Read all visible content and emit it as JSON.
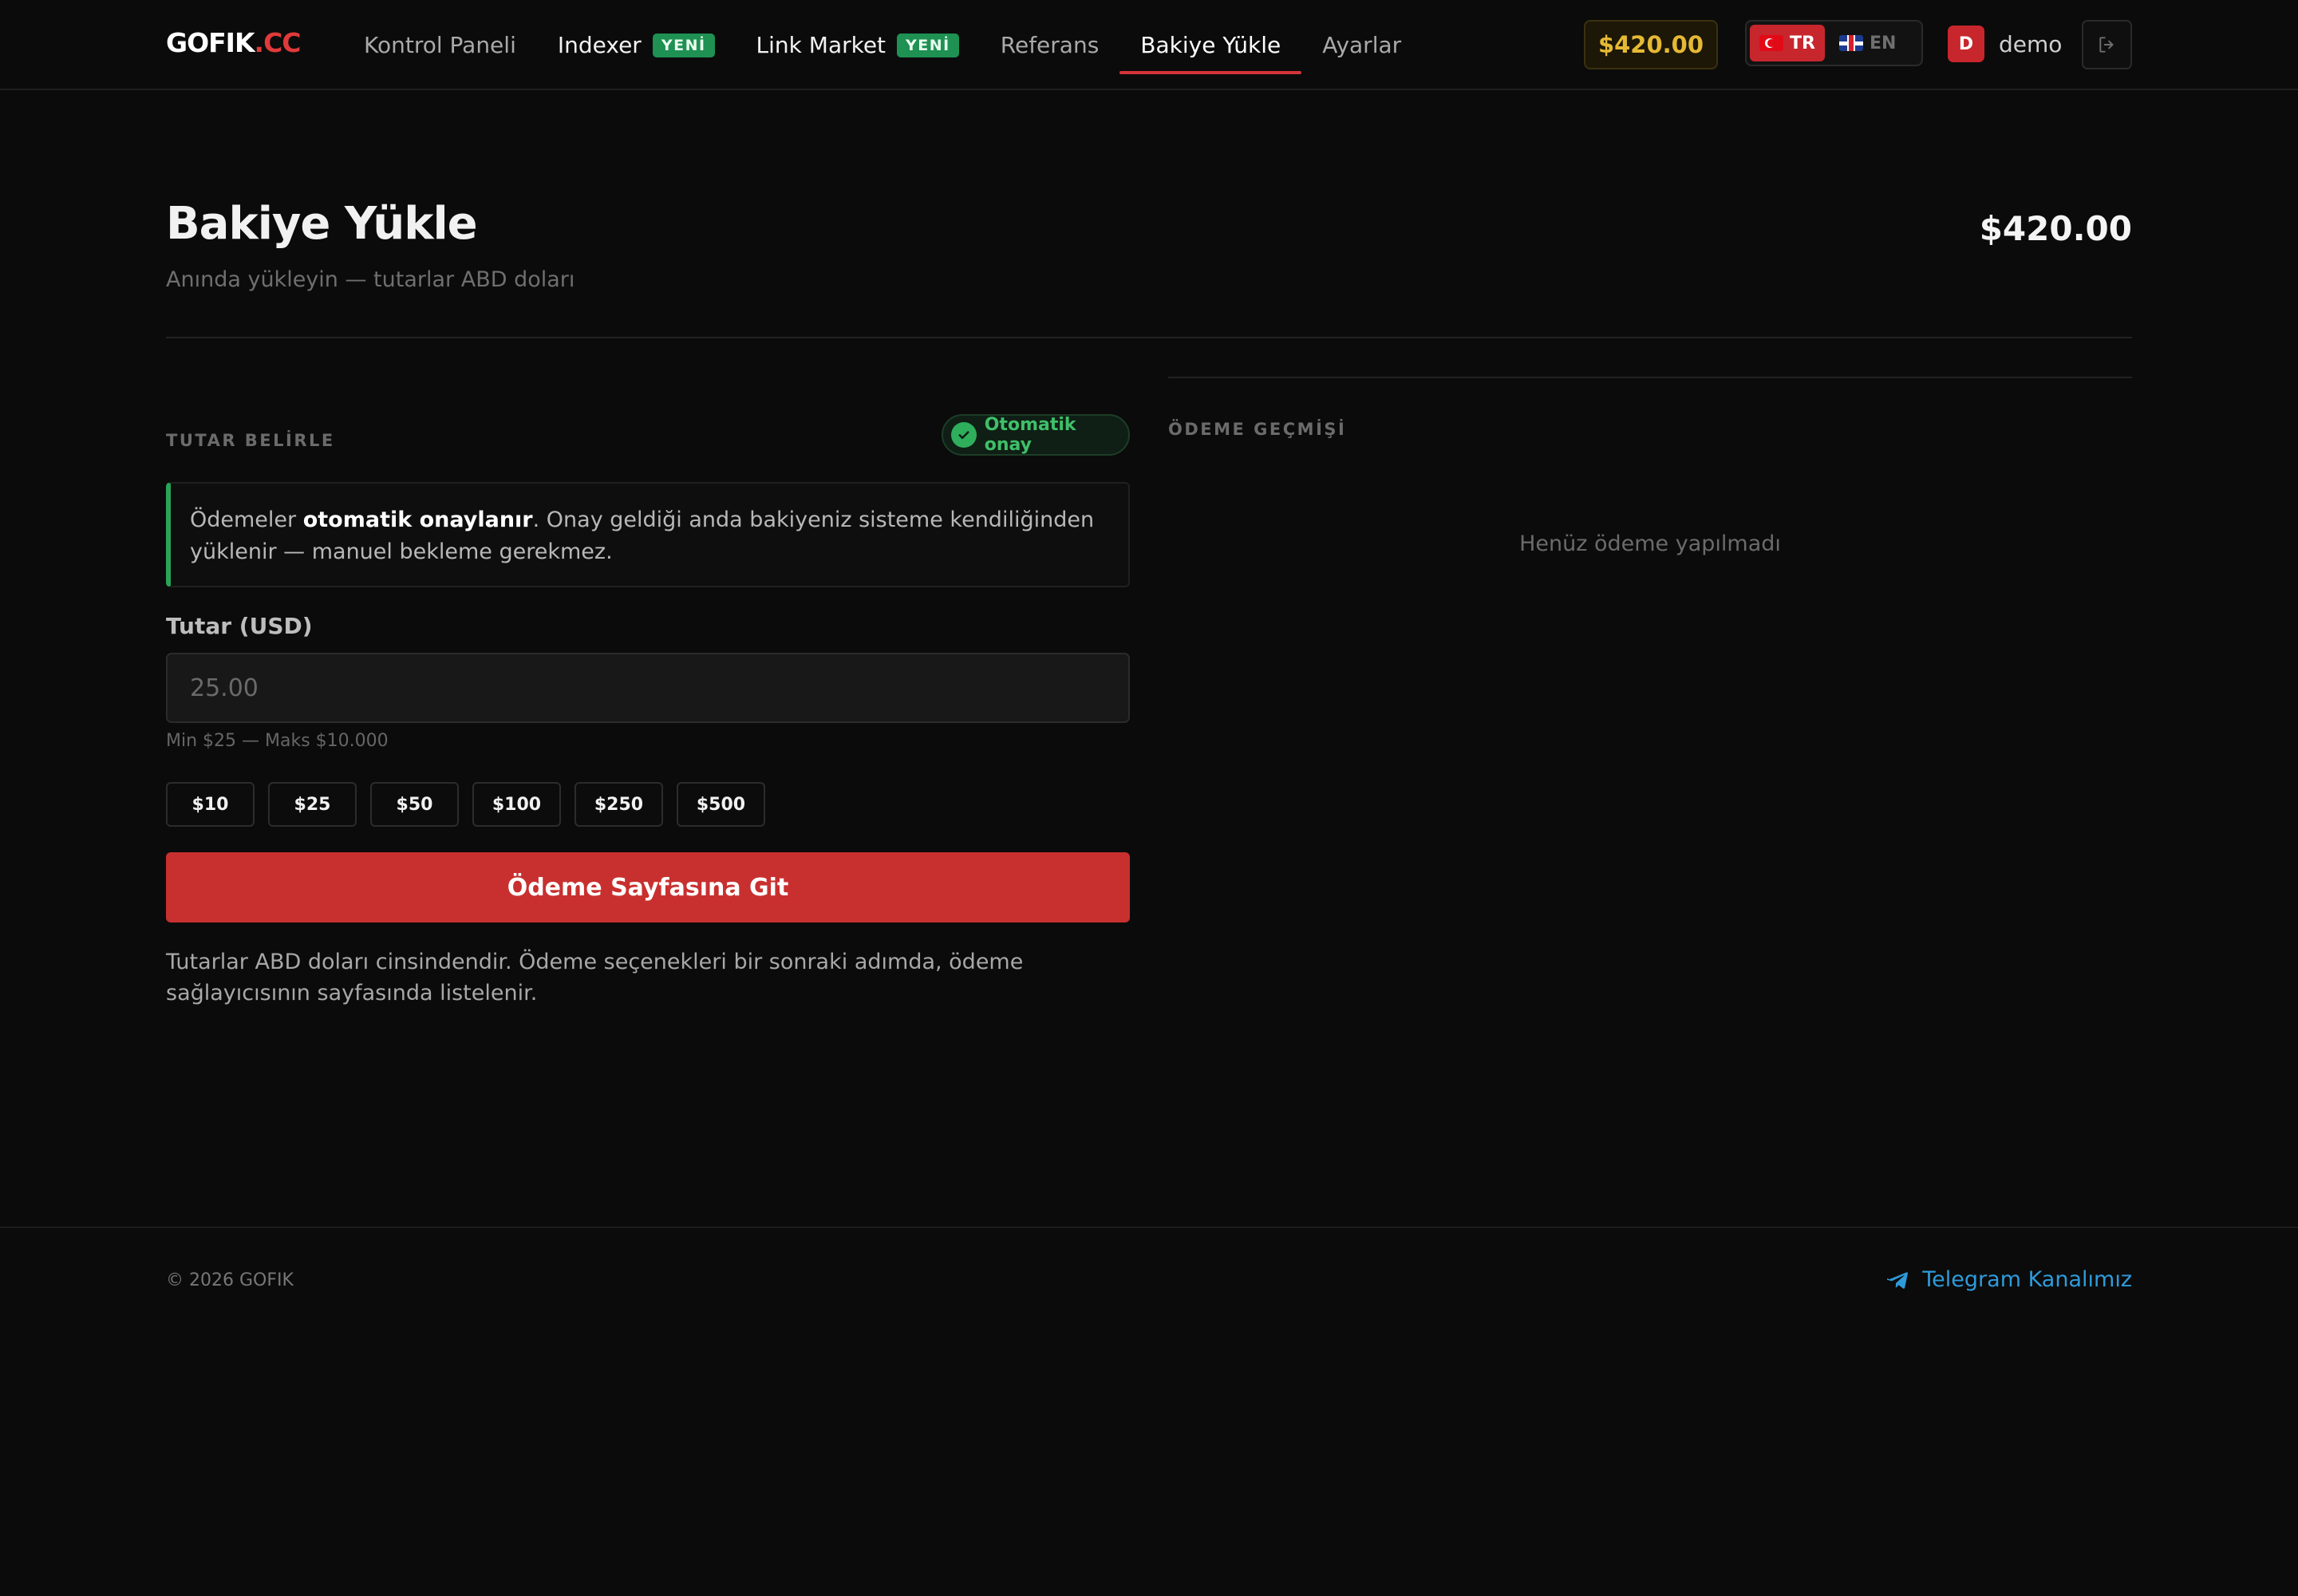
{
  "brand": {
    "name": "GOFIK",
    "suffix": ".CC"
  },
  "nav": {
    "items": [
      {
        "label": "Kontrol Paneli"
      },
      {
        "label": "Indexer",
        "badge": "YENİ"
      },
      {
        "label": "Link Market",
        "badge": "YENİ"
      },
      {
        "label": "Referans"
      },
      {
        "label": "Bakiye Yükle",
        "active": true
      },
      {
        "label": "Ayarlar"
      }
    ]
  },
  "header": {
    "balance": "$420.00",
    "languages": [
      {
        "code": "TR",
        "flag": "turkey-flag-icon",
        "selected": true
      },
      {
        "code": "EN",
        "flag": "uk-flag-icon",
        "selected": false
      }
    ],
    "user": {
      "initial": "D",
      "name": "demo"
    },
    "logout_icon": "logout-icon"
  },
  "page": {
    "title": "Bakiye Yükle",
    "subtitle": "Anında yükleyin — tutarlar ABD doları",
    "balance": "$420.00"
  },
  "topup": {
    "section_label": "TUTAR BELİRLE",
    "auto_badge": "Otomatik onay",
    "info": {
      "before": "Ödemeler ",
      "bold": "otomatik onaylanır",
      "after": ". Onay geldiği anda bakiyeniz sisteme kendiliğinden yüklenir — manuel bekleme gerekmez."
    },
    "amount_label": "Tutar (USD)",
    "amount_value": "",
    "amount_placeholder": "25.00",
    "limits": "Min $25 — Maks $10.000",
    "quick_amounts": [
      "$10",
      "$25",
      "$50",
      "$100",
      "$250",
      "$500"
    ],
    "submit_label": "Ödeme Sayfasına Git",
    "note": "Tutarlar ABD doları cinsindendir. Ödeme seçenekleri bir sonraki adımda, ödeme sağlayıcısının sayfasında listelenir."
  },
  "history": {
    "section_label": "ÖDEME GEÇMİŞİ",
    "empty_text": "Henüz ödeme yapılmadı"
  },
  "footer": {
    "copyright": "© 2026 GOFIK",
    "telegram_label": "Telegram Kanalımız",
    "telegram_icon": "telegram-icon"
  },
  "colors": {
    "accent_red": "#c8302f",
    "success_green": "#2fae5c",
    "balance_gold": "#e5b934",
    "link_blue": "#2e9bda",
    "background": "#0b0b0b"
  }
}
